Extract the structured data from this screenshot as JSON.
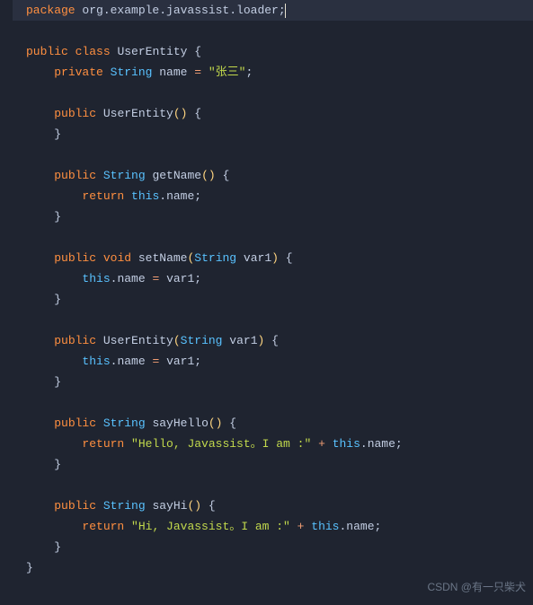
{
  "code": {
    "line1": {
      "kw1": "package",
      "pkg": " org.example.javassist.loader;"
    },
    "line3": {
      "kw1": "public",
      "kw2": "class",
      "name": "UserEntity",
      "brace": " {"
    },
    "line4": {
      "kw1": "private",
      "type": "String",
      "name": " name ",
      "eq": "=",
      "str": " \"张三\"",
      "semi": ";"
    },
    "line6": {
      "kw1": "public",
      "name": "UserEntity",
      "paren": "()",
      "brace": " {"
    },
    "line7": {
      "brace": "}"
    },
    "line9": {
      "kw1": "public",
      "type": "String",
      "name": " getName",
      "paren": "()",
      "brace": " {"
    },
    "line10": {
      "kw1": "return",
      "this": "this",
      "rest": ".name;"
    },
    "line11": {
      "brace": "}"
    },
    "line13": {
      "kw1": "public",
      "kw2": "void",
      "name": " setName",
      "lp": "(",
      "type": "String",
      "param": " var1",
      "rp": ")",
      "brace": " {"
    },
    "line14": {
      "this": "this",
      "dot": ".name ",
      "eq": "=",
      "rest": " var1;"
    },
    "line15": {
      "brace": "}"
    },
    "line17": {
      "kw1": "public",
      "name": "UserEntity",
      "lp": "(",
      "type": "String",
      "param": " var1",
      "rp": ")",
      "brace": " {"
    },
    "line18": {
      "this": "this",
      "dot": ".name ",
      "eq": "=",
      "rest": " var1;"
    },
    "line19": {
      "brace": "}"
    },
    "line21": {
      "kw1": "public",
      "type": "String",
      "name": " sayHello",
      "paren": "()",
      "brace": " {"
    },
    "line22": {
      "kw1": "return",
      "str": " \"Hello, Javassist。I am :\"",
      "op": " + ",
      "this": "this",
      "rest": ".name;"
    },
    "line23": {
      "brace": "}"
    },
    "line25": {
      "kw1": "public",
      "type": "String",
      "name": " sayHi",
      "paren": "()",
      "brace": " {"
    },
    "line26": {
      "kw1": "return",
      "str": " \"Hi, Javassist。I am :\"",
      "op": " + ",
      "this": "this",
      "rest": ".name;"
    },
    "line27": {
      "brace": "}"
    },
    "line28": {
      "brace": "}"
    }
  },
  "watermark": "CSDN @有一只柴犬"
}
